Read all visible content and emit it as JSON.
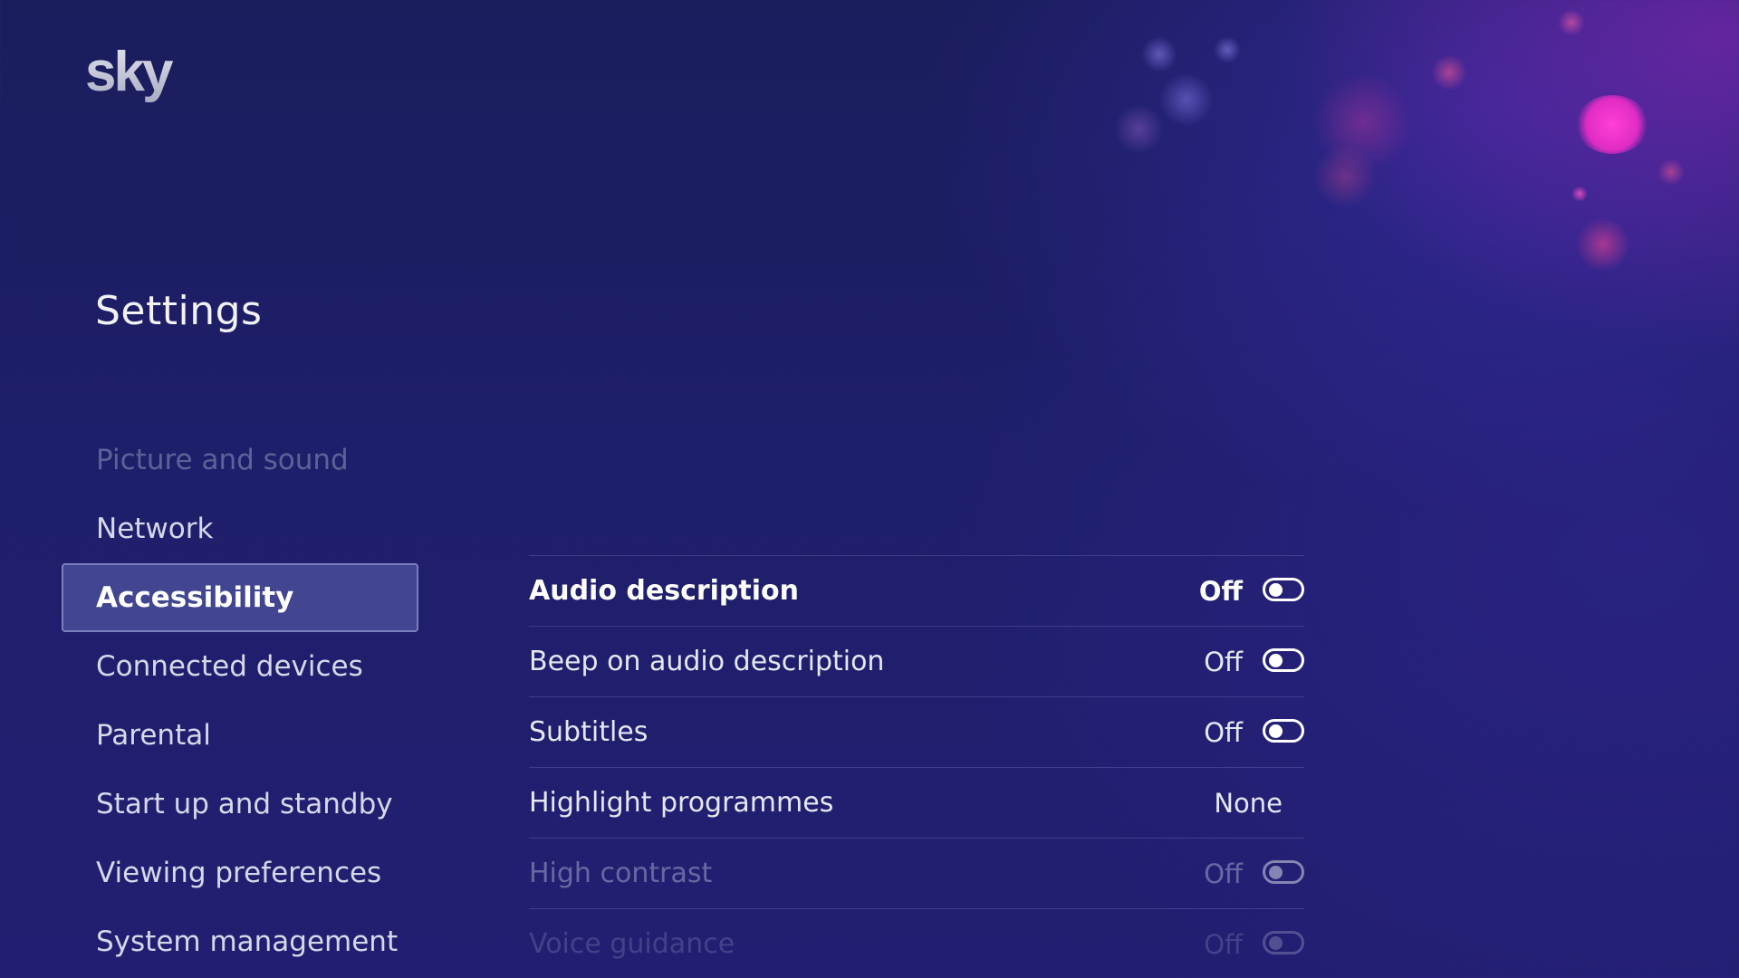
{
  "brand": {
    "logo_text": "sky"
  },
  "page": {
    "title": "Settings"
  },
  "sidebar": {
    "items": [
      {
        "label": "Picture and sound",
        "state": "faded"
      },
      {
        "label": "Network",
        "state": "normal"
      },
      {
        "label": "Accessibility",
        "state": "selected"
      },
      {
        "label": "Connected devices",
        "state": "normal"
      },
      {
        "label": "Parental",
        "state": "normal"
      },
      {
        "label": "Start up and standby",
        "state": "normal"
      },
      {
        "label": "Viewing preferences",
        "state": "normal"
      },
      {
        "label": "System management",
        "state": "normal"
      }
    ]
  },
  "accessibility": {
    "rows": [
      {
        "label": "Audio description",
        "value": "Off",
        "control": "toggle",
        "checked": false,
        "state": "focused"
      },
      {
        "label": "Beep on audio description",
        "value": "Off",
        "control": "toggle",
        "checked": false,
        "state": "normal"
      },
      {
        "label": "Subtitles",
        "value": "Off",
        "control": "toggle",
        "checked": false,
        "state": "normal"
      },
      {
        "label": "Highlight programmes",
        "value": "None",
        "control": "value",
        "state": "normal"
      },
      {
        "label": "High contrast",
        "value": "Off",
        "control": "toggle",
        "checked": false,
        "state": "dim"
      },
      {
        "label": "Voice guidance",
        "value": "Off",
        "control": "toggle",
        "checked": false,
        "state": "dimmer"
      }
    ]
  },
  "colors": {
    "background": "#1e1f6a",
    "selected_item_bg": "#5f64af",
    "text": "#ffffff"
  }
}
